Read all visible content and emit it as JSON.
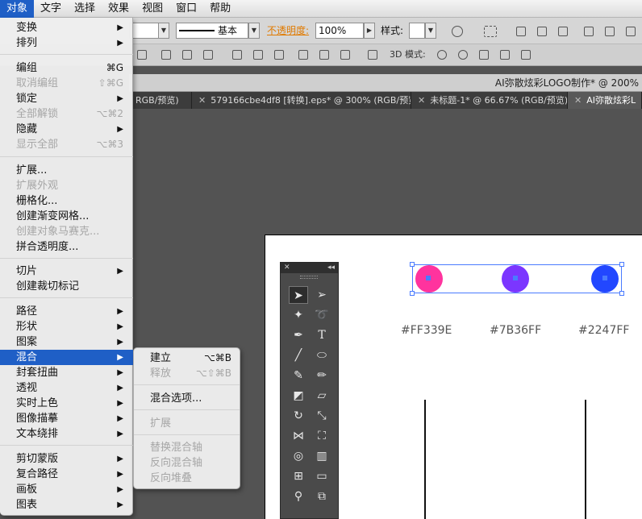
{
  "menubar": {
    "items": [
      "对象",
      "文字",
      "选择",
      "效果",
      "视图",
      "窗口",
      "帮助"
    ]
  },
  "controlbar": {
    "stroke_label": "基本",
    "opacity_label": "不透明度:",
    "opacity_value": "100%",
    "style_label": "样式:",
    "mode3d_label": "3D 模式:"
  },
  "document": {
    "window_title": "AI弥散炫彩LOGO制作* @ 200%",
    "tabs": [
      {
        "label": "RGB/预览)",
        "active": false
      },
      {
        "label": "579166cbe4df8 [转换].eps* @ 300% (RGB/预览)",
        "active": false
      },
      {
        "label": "未标题-1* @ 66.67% (RGB/预览)",
        "active": false
      },
      {
        "label": "AI弥散炫彩L",
        "active": true
      }
    ]
  },
  "menu": {
    "items": [
      {
        "label": "变换",
        "submenu": true
      },
      {
        "label": "排列",
        "submenu": true
      },
      {
        "label": "编组",
        "shortcut": "⌘G"
      },
      {
        "label": "取消编组",
        "shortcut": "⇧⌘G",
        "disabled": true
      },
      {
        "label": "锁定",
        "submenu": true
      },
      {
        "label": "全部解锁",
        "shortcut": "⌥⌘2",
        "disabled": true
      },
      {
        "label": "隐藏",
        "submenu": true
      },
      {
        "label": "显示全部",
        "shortcut": "⌥⌘3",
        "disabled": true
      },
      {
        "label": "扩展..."
      },
      {
        "label": "扩展外观",
        "disabled": true
      },
      {
        "label": "栅格化..."
      },
      {
        "label": "创建渐变网格..."
      },
      {
        "label": "创建对象马赛克...",
        "disabled": true
      },
      {
        "label": "拼合透明度..."
      },
      {
        "label": "切片",
        "submenu": true
      },
      {
        "label": "创建裁切标记"
      },
      {
        "label": "路径",
        "submenu": true
      },
      {
        "label": "形状",
        "submenu": true
      },
      {
        "label": "图案",
        "submenu": true
      },
      {
        "label": "混合",
        "submenu": true,
        "highlighted": true
      },
      {
        "label": "封套扭曲",
        "submenu": true
      },
      {
        "label": "透视",
        "submenu": true
      },
      {
        "label": "实时上色",
        "submenu": true
      },
      {
        "label": "图像描摹",
        "submenu": true
      },
      {
        "label": "文本绕排",
        "submenu": true
      },
      {
        "label": "剪切蒙版",
        "submenu": true
      },
      {
        "label": "复合路径",
        "submenu": true
      },
      {
        "label": "画板",
        "submenu": true
      },
      {
        "label": "图表",
        "submenu": true
      }
    ]
  },
  "submenu_blend": {
    "items": [
      {
        "label": "建立",
        "shortcut": "⌥⌘B"
      },
      {
        "label": "释放",
        "shortcut": "⌥⇧⌘B",
        "disabled": true
      },
      {
        "label": "混合选项..."
      },
      {
        "label": "扩展",
        "disabled": true
      },
      {
        "label": "替换混合轴",
        "disabled": true
      },
      {
        "label": "反向混合轴",
        "disabled": true
      },
      {
        "label": "反向堆叠",
        "disabled": true
      }
    ]
  },
  "canvas": {
    "swatches": [
      {
        "hex": "#FF339E",
        "color": "#FF339E"
      },
      {
        "hex": "#7B36FF",
        "color": "#7B36FF"
      },
      {
        "hex": "#2247FF",
        "color": "#2247FF"
      }
    ]
  },
  "colors": {
    "menu_highlight": "#1f5fc6",
    "opacity_label": "#e07a00"
  }
}
